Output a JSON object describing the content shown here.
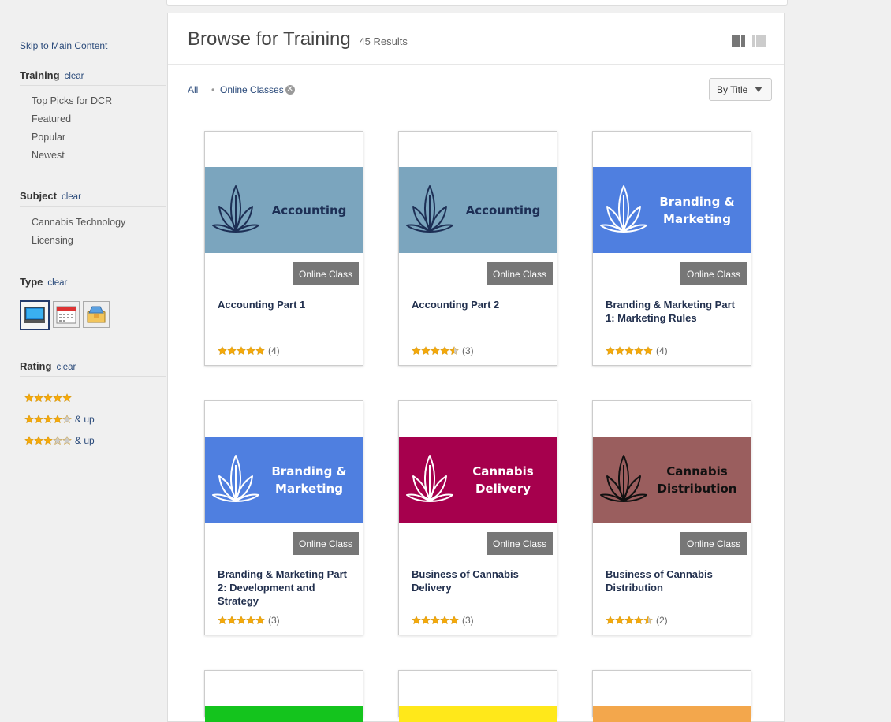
{
  "sidebar": {
    "skip_link": "Skip to Main Content",
    "training": {
      "label": "Training",
      "clear": "clear",
      "items": [
        "Top Picks for DCR",
        "Featured",
        "Popular",
        "Newest"
      ]
    },
    "subject": {
      "label": "Subject",
      "clear": "clear",
      "items": [
        "Cannabis Technology",
        "Licensing"
      ]
    },
    "type": {
      "label": "Type",
      "clear": "clear",
      "icons": [
        "computer-icon",
        "calendar-icon",
        "package-icon"
      ],
      "selected": "computer-icon"
    },
    "rating": {
      "label": "Rating",
      "clear": "clear",
      "rows": [
        {
          "stars": 5,
          "suffix": ""
        },
        {
          "stars": 4,
          "suffix": "& up"
        },
        {
          "stars": 3,
          "suffix": "& up"
        }
      ]
    }
  },
  "main": {
    "title": "Browse for Training",
    "results": "45 Results",
    "filter_all": "All",
    "active_filter": "Online Classes",
    "sort_label": "By Title",
    "cards": [
      {
        "title": "Accounting Part 1",
        "image_text": "Accounting",
        "image_bg": "#7ba5be",
        "image_fg": "#1d2f55",
        "leaf": "#1d2f55",
        "badge": "Online Class",
        "rating": 5,
        "count": "(4)"
      },
      {
        "title": "Accounting Part 2",
        "image_text": "Accounting",
        "image_bg": "#7ba5be",
        "image_fg": "#1d2f55",
        "leaf": "#1d2f55",
        "badge": "Online Class",
        "rating": 4.5,
        "count": "(3)"
      },
      {
        "title": "Branding & Marketing Part 1: Marketing Rules",
        "image_text": "Branding & Marketing",
        "image_bg": "#4f7fe0",
        "image_fg": "#ffffff",
        "leaf": "#ffffff",
        "badge": "Online Class",
        "rating": 5,
        "count": "(4)"
      },
      {
        "title": "Branding & Marketing Part 2: Development and Strategy",
        "image_text": "Branding & Marketing",
        "image_bg": "#4f7fe0",
        "image_fg": "#ffffff",
        "leaf": "#ffffff",
        "badge": "Online Class",
        "rating": 5,
        "count": "(3)"
      },
      {
        "title": "Business of Cannabis Delivery",
        "image_text": "Cannabis Delivery",
        "image_bg": "#a6004d",
        "image_fg": "#ffffff",
        "leaf": "#ffffff",
        "badge": "Online Class",
        "rating": 5,
        "count": "(3)"
      },
      {
        "title": "Business of Cannabis Distribution",
        "image_text": "Cannabis Distribution",
        "image_bg": "#9a5e5e",
        "image_fg": "#111111",
        "leaf": "#111111",
        "badge": "Online Class",
        "rating": 4.5,
        "count": "(2)"
      }
    ],
    "partial_cards": [
      "#14c41d",
      "#ffe81a",
      "#f3a74c"
    ]
  },
  "colors": {
    "star": "#f5a90a",
    "star_empty": "#cccccc",
    "link": "#2a4a7a"
  }
}
